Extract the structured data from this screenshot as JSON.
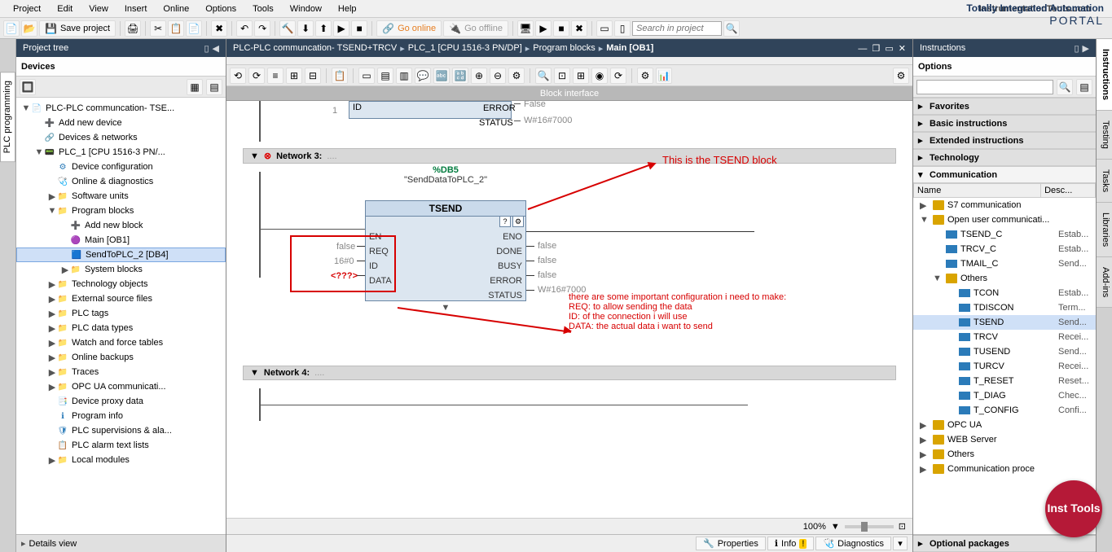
{
  "menubar": [
    "Project",
    "Edit",
    "View",
    "Insert",
    "Online",
    "Options",
    "Tools",
    "Window",
    "Help"
  ],
  "site_watermark": "InstrumentationTools.com",
  "brand": {
    "line1": "Totally Integrated Automation",
    "line2": "PORTAL"
  },
  "toolbar": {
    "save_label": "Save project",
    "go_online": "Go online",
    "go_offline": "Go offline",
    "search_placeholder": "Search in project"
  },
  "left": {
    "title": "Project tree",
    "tab": "Devices",
    "vtab": "PLC programming",
    "details": "Details view",
    "tree": [
      {
        "d": 0,
        "exp": "▼",
        "icon": "📄",
        "cls": "",
        "label": "PLC-PLC communcation- TSE..."
      },
      {
        "d": 1,
        "exp": "",
        "icon": "➕",
        "cls": "device",
        "label": "Add new device"
      },
      {
        "d": 1,
        "exp": "",
        "icon": "🔗",
        "cls": "device",
        "label": "Devices & networks"
      },
      {
        "d": 1,
        "exp": "▼",
        "icon": "📟",
        "cls": "device",
        "label": "PLC_1 [CPU 1516-3 PN/..."
      },
      {
        "d": 2,
        "exp": "",
        "icon": "⚙",
        "cls": "block",
        "label": "Device configuration"
      },
      {
        "d": 2,
        "exp": "",
        "icon": "🩺",
        "cls": "block",
        "label": "Online & diagnostics"
      },
      {
        "d": 2,
        "exp": "▶",
        "icon": "📁",
        "cls": "folder",
        "label": "Software units"
      },
      {
        "d": 2,
        "exp": "▼",
        "icon": "📁",
        "cls": "folder",
        "label": "Program blocks"
      },
      {
        "d": 3,
        "exp": "",
        "icon": "➕",
        "cls": "block",
        "label": "Add new block"
      },
      {
        "d": 3,
        "exp": "",
        "icon": "🟣",
        "cls": "",
        "label": "Main [OB1]"
      },
      {
        "d": 3,
        "exp": "",
        "icon": "🟦",
        "cls": "",
        "label": "SendToPLC_2 [DB4]",
        "sel": true
      },
      {
        "d": 3,
        "exp": "▶",
        "icon": "📁",
        "cls": "folder",
        "label": "System blocks"
      },
      {
        "d": 2,
        "exp": "▶",
        "icon": "📁",
        "cls": "folder",
        "label": "Technology objects"
      },
      {
        "d": 2,
        "exp": "▶",
        "icon": "📁",
        "cls": "folder",
        "label": "External source files"
      },
      {
        "d": 2,
        "exp": "▶",
        "icon": "📁",
        "cls": "folder",
        "label": "PLC tags"
      },
      {
        "d": 2,
        "exp": "▶",
        "icon": "📁",
        "cls": "folder",
        "label": "PLC data types"
      },
      {
        "d": 2,
        "exp": "▶",
        "icon": "📁",
        "cls": "folder",
        "label": "Watch and force tables"
      },
      {
        "d": 2,
        "exp": "▶",
        "icon": "📁",
        "cls": "folder",
        "label": "Online backups"
      },
      {
        "d": 2,
        "exp": "▶",
        "icon": "📁",
        "cls": "folder",
        "label": "Traces"
      },
      {
        "d": 2,
        "exp": "▶",
        "icon": "📁",
        "cls": "folder",
        "label": "OPC UA communicati..."
      },
      {
        "d": 2,
        "exp": "",
        "icon": "📑",
        "cls": "block",
        "label": "Device proxy data"
      },
      {
        "d": 2,
        "exp": "",
        "icon": "ℹ",
        "cls": "block",
        "label": "Program info"
      },
      {
        "d": 2,
        "exp": "",
        "icon": "🛡",
        "cls": "block",
        "label": "PLC supervisions & ala..."
      },
      {
        "d": 2,
        "exp": "",
        "icon": "📋",
        "cls": "block",
        "label": "PLC alarm text lists"
      },
      {
        "d": 2,
        "exp": "▶",
        "icon": "📁",
        "cls": "folder",
        "label": "Local modules"
      }
    ]
  },
  "center": {
    "crumbs": [
      "PLC-PLC communcation- TSEND+TRCV",
      "PLC_1 [CPU 1516-3 PN/DP]",
      "Program blocks",
      "Main [OB1]"
    ],
    "block_interface": "Block interface",
    "net1": {
      "id_label": "ID",
      "id_val": "1",
      "error_label": "ERROR",
      "error_val": "False",
      "status_label": "STATUS",
      "status_val": "W#16#7000"
    },
    "net3": {
      "title": "Network 3:",
      "db": "%DB5",
      "inst": "\"SendDataToPLC_2\"",
      "fb_title": "TSEND",
      "pins_left": [
        {
          "name": "EN",
          "val": ""
        },
        {
          "name": "REQ",
          "val": "false"
        },
        {
          "name": "ID",
          "val": "16#0"
        },
        {
          "name": "DATA",
          "val": "<???>"
        }
      ],
      "pins_right": [
        {
          "name": "ENO",
          "val": ""
        },
        {
          "name": "DONE",
          "val": "false"
        },
        {
          "name": "BUSY",
          "val": "false"
        },
        {
          "name": "ERROR",
          "val": "false"
        },
        {
          "name": "STATUS",
          "val": "W#16#7000"
        }
      ]
    },
    "net4": {
      "title": "Network 4:"
    },
    "zoom": "100%",
    "bottom_tabs": [
      "Properties",
      "Info",
      "Diagnostics"
    ],
    "annotations": {
      "a1": "This is the TSEND block",
      "a2": "there are some important configuration i need to make:",
      "a3": "REQ: to allow sending the data",
      "a4": "ID: of the connection i will use",
      "a5": "DATA: the actual data i want to send"
    }
  },
  "right": {
    "title": "Instructions",
    "options": "Options",
    "sections": [
      "Favorites",
      "Basic instructions",
      "Extended instructions",
      "Technology",
      "Communication"
    ],
    "cols": {
      "name": "Name",
      "desc": "Desc..."
    },
    "tree": [
      {
        "d": 0,
        "exp": "▶",
        "icon": "folder",
        "label": "S7 communication",
        "desc": ""
      },
      {
        "d": 0,
        "exp": "▼",
        "icon": "folder",
        "label": "Open user communicati...",
        "desc": ""
      },
      {
        "d": 1,
        "exp": "",
        "icon": "instr",
        "label": "TSEND_C",
        "desc": "Estab..."
      },
      {
        "d": 1,
        "exp": "",
        "icon": "instr",
        "label": "TRCV_C",
        "desc": "Estab..."
      },
      {
        "d": 1,
        "exp": "",
        "icon": "instr",
        "label": "TMAIL_C",
        "desc": "Send..."
      },
      {
        "d": 1,
        "exp": "▼",
        "icon": "folder",
        "label": "Others",
        "desc": ""
      },
      {
        "d": 2,
        "exp": "",
        "icon": "instr",
        "label": "TCON",
        "desc": "Estab..."
      },
      {
        "d": 2,
        "exp": "",
        "icon": "instr",
        "label": "TDISCON",
        "desc": "Term..."
      },
      {
        "d": 2,
        "exp": "",
        "icon": "instr",
        "label": "TSEND",
        "desc": "Send...",
        "sel": true
      },
      {
        "d": 2,
        "exp": "",
        "icon": "instr",
        "label": "TRCV",
        "desc": "Recei..."
      },
      {
        "d": 2,
        "exp": "",
        "icon": "instr",
        "label": "TUSEND",
        "desc": "Send..."
      },
      {
        "d": 2,
        "exp": "",
        "icon": "instr",
        "label": "TURCV",
        "desc": "Recei..."
      },
      {
        "d": 2,
        "exp": "",
        "icon": "instr",
        "label": "T_RESET",
        "desc": "Reset..."
      },
      {
        "d": 2,
        "exp": "",
        "icon": "instr",
        "label": "T_DIAG",
        "desc": "Chec..."
      },
      {
        "d": 2,
        "exp": "",
        "icon": "instr",
        "label": "T_CONFIG",
        "desc": "Confi..."
      },
      {
        "d": 0,
        "exp": "▶",
        "icon": "folder",
        "label": "OPC UA",
        "desc": ""
      },
      {
        "d": 0,
        "exp": "▶",
        "icon": "folder",
        "label": "WEB Server",
        "desc": ""
      },
      {
        "d": 0,
        "exp": "▶",
        "icon": "folder",
        "label": "Others",
        "desc": ""
      },
      {
        "d": 0,
        "exp": "▶",
        "icon": "folder",
        "label": "Communication proce",
        "desc": ""
      }
    ],
    "optional": "Optional packages",
    "vtabs": [
      "Instructions",
      "Testing",
      "Tasks",
      "Libraries",
      "Add-ins"
    ]
  },
  "badge": "Inst Tools"
}
